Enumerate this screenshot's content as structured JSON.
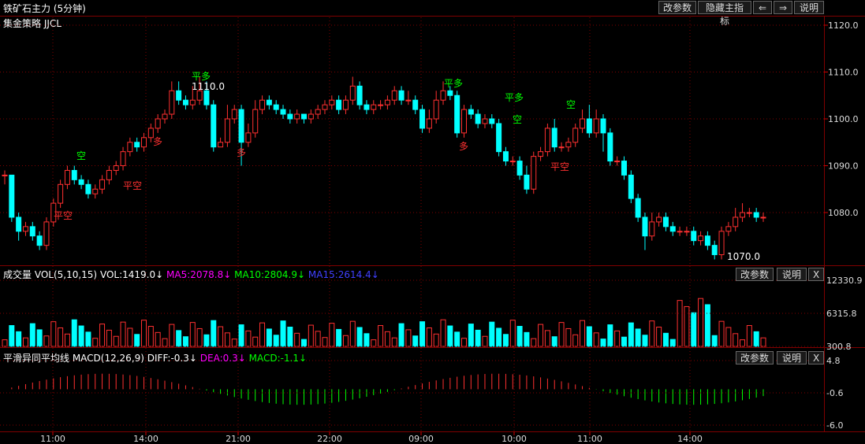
{
  "header": {
    "title": "铁矿石主力 (5分钟)",
    "strategy": "集金策略 JJCL",
    "buttons": [
      "改参数",
      "隐藏主指标",
      "⇐",
      "⇒",
      "说明"
    ]
  },
  "price_axis": {
    "ticks": [
      "1120.0",
      "1110.0",
      "1100.0",
      "1090.0",
      "1080.0"
    ]
  },
  "annotations": {
    "high_label": "1110.0",
    "low_label": "1070.0",
    "signals": [
      "平空",
      "空",
      "平空",
      "多",
      "平多",
      "多",
      "平多",
      "多",
      "平多",
      "空",
      "平空",
      "空"
    ]
  },
  "volume_panel": {
    "name": "成交量 VOL(5,10,15)",
    "vol": "VOL:1419.0↓",
    "ma5": "MA5:2078.8↓",
    "ma10": "MA10:2804.9↓",
    "ma15": "MA15:2614.4↓",
    "buttons": [
      "改参数",
      "说明",
      "X"
    ],
    "ticks": [
      "12330.9",
      "6315.8",
      "300.8"
    ]
  },
  "macd_panel": {
    "name": "平滑异同平均线 MACD(12,26,9)",
    "diff": "DIFF:-0.3↓",
    "dea": "DEA:0.3↓",
    "macd": "MACD:-1.1↓",
    "buttons": [
      "改参数",
      "说明",
      "X"
    ],
    "ticks": [
      "4.8",
      "-0.6",
      "-6.0"
    ]
  },
  "time_axis": [
    "11:00",
    "14:00",
    "21:00",
    "22:00",
    "09:00",
    "10:00",
    "11:00",
    "14:00"
  ],
  "colors": {
    "up": "#ff3030",
    "down": "#00ffff",
    "ma5": "#ff00ff",
    "ma10": "#00ff00",
    "ma15": "#4040ff",
    "grid": "#800000"
  },
  "chart_data": {
    "type": "candlestick",
    "price_range": [
      1070,
      1120
    ],
    "candles": [
      [
        1088,
        1088,
        1086,
        1089
      ],
      [
        1088,
        1079,
        1078,
        1088
      ],
      [
        1079,
        1076,
        1074,
        1080
      ],
      [
        1076,
        1077,
        1075,
        1078
      ],
      [
        1077,
        1075,
        1074,
        1078
      ],
      [
        1075,
        1073,
        1072,
        1076
      ],
      [
        1073,
        1078,
        1072,
        1079
      ],
      [
        1078,
        1082,
        1077,
        1083
      ],
      [
        1082,
        1086,
        1081,
        1087
      ],
      [
        1086,
        1089,
        1085,
        1090
      ],
      [
        1089,
        1087,
        1086,
        1090
      ],
      [
        1087,
        1086,
        1085,
        1088
      ],
      [
        1086,
        1084,
        1083,
        1087
      ],
      [
        1084,
        1085,
        1083,
        1086
      ],
      [
        1085,
        1087,
        1084,
        1088
      ],
      [
        1087,
        1089,
        1086,
        1090
      ],
      [
        1089,
        1090,
        1088,
        1091
      ],
      [
        1090,
        1093,
        1089,
        1094
      ],
      [
        1093,
        1095,
        1092,
        1096
      ],
      [
        1095,
        1094,
        1093,
        1096
      ],
      [
        1094,
        1096,
        1093,
        1097
      ],
      [
        1096,
        1098,
        1095,
        1099
      ],
      [
        1098,
        1100,
        1097,
        1101
      ],
      [
        1100,
        1101,
        1099,
        1102
      ],
      [
        1101,
        1106,
        1100,
        1108
      ],
      [
        1106,
        1104,
        1103,
        1108
      ],
      [
        1104,
        1103,
        1102,
        1105
      ],
      [
        1103,
        1104,
        1102,
        1107
      ],
      [
        1104,
        1106,
        1103,
        1109
      ],
      [
        1106,
        1103,
        1102,
        1108
      ],
      [
        1103,
        1094,
        1093,
        1104
      ],
      [
        1094,
        1095,
        1094,
        1096
      ],
      [
        1095,
        1100,
        1094,
        1103
      ],
      [
        1100,
        1102,
        1099,
        1103
      ],
      [
        1102,
        1095,
        1090,
        1103
      ],
      [
        1095,
        1097,
        1094,
        1099
      ],
      [
        1097,
        1102,
        1096,
        1104
      ],
      [
        1102,
        1104,
        1101,
        1105
      ],
      [
        1104,
        1103,
        1102,
        1105
      ],
      [
        1103,
        1102,
        1101,
        1104
      ],
      [
        1102,
        1101,
        1100,
        1103
      ],
      [
        1101,
        1100,
        1099,
        1102
      ],
      [
        1100,
        1101,
        1099,
        1102
      ],
      [
        1101,
        1100,
        1099,
        1101
      ],
      [
        1100,
        1101,
        1099,
        1102
      ],
      [
        1101,
        1102,
        1100,
        1103
      ],
      [
        1102,
        1103,
        1101,
        1104
      ],
      [
        1103,
        1104,
        1102,
        1105
      ],
      [
        1104,
        1102,
        1101,
        1105
      ],
      [
        1102,
        1104,
        1101,
        1105
      ],
      [
        1104,
        1107,
        1103,
        1109
      ],
      [
        1107,
        1103,
        1102,
        1108
      ],
      [
        1103,
        1102,
        1101,
        1104
      ],
      [
        1102,
        1103,
        1101,
        1104
      ],
      [
        1103,
        1103,
        1102,
        1104
      ],
      [
        1103,
        1104,
        1102,
        1105
      ],
      [
        1104,
        1106,
        1103,
        1107
      ],
      [
        1106,
        1104,
        1103,
        1107
      ],
      [
        1104,
        1104,
        1103,
        1106
      ],
      [
        1104,
        1102,
        1101,
        1105
      ],
      [
        1102,
        1098,
        1097,
        1103
      ],
      [
        1098,
        1100,
        1097,
        1102
      ],
      [
        1100,
        1104,
        1099,
        1106
      ],
      [
        1104,
        1106,
        1103,
        1108
      ],
      [
        1106,
        1105,
        1104,
        1107
      ],
      [
        1105,
        1097,
        1096,
        1106
      ],
      [
        1097,
        1102,
        1096,
        1103
      ],
      [
        1102,
        1101,
        1100,
        1103
      ],
      [
        1101,
        1099,
        1098,
        1102
      ],
      [
        1099,
        1100,
        1098,
        1101
      ],
      [
        1100,
        1099,
        1098,
        1101
      ],
      [
        1099,
        1093,
        1092,
        1100
      ],
      [
        1093,
        1091,
        1090,
        1094
      ],
      [
        1091,
        1091,
        1090,
        1092
      ],
      [
        1091,
        1088,
        1087,
        1092
      ],
      [
        1088,
        1085,
        1084,
        1090
      ],
      [
        1085,
        1092,
        1084,
        1093
      ],
      [
        1092,
        1093,
        1091,
        1094
      ],
      [
        1093,
        1098,
        1092,
        1099
      ],
      [
        1098,
        1094,
        1093,
        1100
      ],
      [
        1094,
        1094,
        1093,
        1095
      ],
      [
        1094,
        1095,
        1093,
        1096
      ],
      [
        1095,
        1098,
        1094,
        1099
      ],
      [
        1098,
        1100,
        1097,
        1102
      ],
      [
        1100,
        1097,
        1096,
        1103
      ],
      [
        1097,
        1100,
        1096,
        1102
      ],
      [
        1100,
        1097,
        1093,
        1101
      ],
      [
        1097,
        1091,
        1090,
        1098
      ],
      [
        1091,
        1091,
        1090,
        1092
      ],
      [
        1091,
        1088,
        1087,
        1092
      ],
      [
        1088,
        1083,
        1082,
        1089
      ],
      [
        1083,
        1079,
        1078,
        1084
      ],
      [
        1079,
        1075,
        1072,
        1080
      ],
      [
        1075,
        1078,
        1074,
        1080
      ],
      [
        1078,
        1079,
        1077,
        1080
      ],
      [
        1079,
        1077,
        1076,
        1080
      ],
      [
        1077,
        1076,
        1075,
        1078
      ],
      [
        1076,
        1076,
        1075,
        1077
      ],
      [
        1076,
        1076,
        1075,
        1077
      ],
      [
        1076,
        1074,
        1073,
        1077
      ],
      [
        1074,
        1075,
        1073,
        1076
      ],
      [
        1075,
        1073,
        1072,
        1076
      ],
      [
        1073,
        1071,
        1070,
        1074
      ],
      [
        1071,
        1076,
        1070,
        1077
      ],
      [
        1076,
        1077,
        1075,
        1078
      ],
      [
        1077,
        1079,
        1076,
        1081
      ],
      [
        1079,
        1080,
        1078,
        1082
      ],
      [
        1080,
        1080,
        1079,
        1081
      ],
      [
        1080,
        1079,
        1078,
        1081
      ],
      [
        1079,
        1079,
        1078,
        1080
      ]
    ],
    "volume_range": [
      300.8,
      12330.9
    ],
    "macd_range": [
      -6.0,
      4.8
    ]
  }
}
